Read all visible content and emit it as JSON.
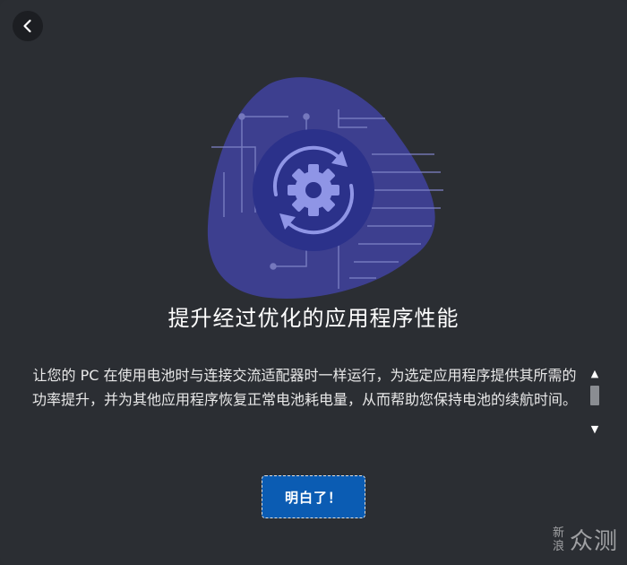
{
  "dialog": {
    "back_icon": "chevron-left-icon",
    "hero_icon": "gear-sync-icon",
    "title": "提升经过优化的应用程序性能",
    "description": "让您的 PC 在使用电池时与连接交流适配器时一样运行，为选定应用程序提供其所需的功率提升，并为其他应用程序恢复正常电池耗电量，从而帮助您保持电池的续航时间。",
    "confirm_label": "明白了！"
  },
  "scrollbar": {
    "up_icon": "arrow-up-icon",
    "down_icon": "arrow-down-icon",
    "up_glyph": "▲",
    "down_glyph": "▼"
  },
  "watermark": {
    "small_top": "新",
    "small_bottom": "浪",
    "big": "众测"
  },
  "colors": {
    "background": "#2b2e33",
    "blob": "#3d3f8f",
    "circle": "#2b318a",
    "gear": "#8f95e6",
    "button": "#0b5cb3"
  }
}
